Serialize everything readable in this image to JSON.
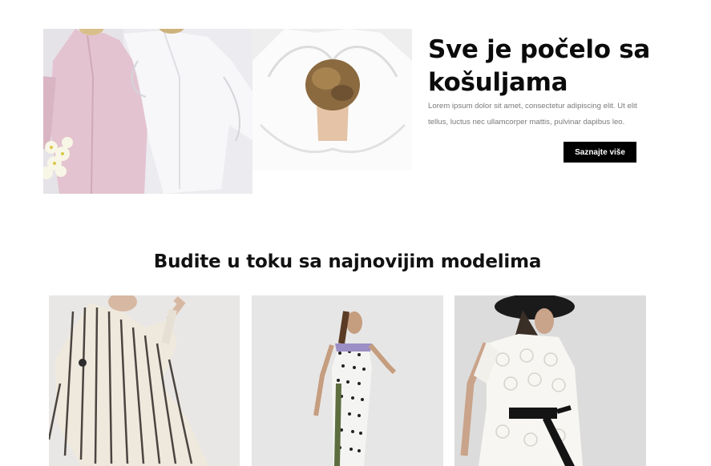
{
  "hero": {
    "title": "Sve je počelo sa košuljama",
    "body": "Lorem ipsum dolor sit amet, consectetur adipiscing elit. Ut elit tellus, luctus nec ullamcorper mattis, pulvinar dapibus leo.",
    "button_label": "Saznajte više"
  },
  "latest": {
    "title": "Budite u toku sa najnovijim modelima"
  },
  "colors": {
    "button_bg": "#000000",
    "button_text": "#ffffff",
    "heading": "#111111",
    "body_text": "#7a7a7a"
  }
}
